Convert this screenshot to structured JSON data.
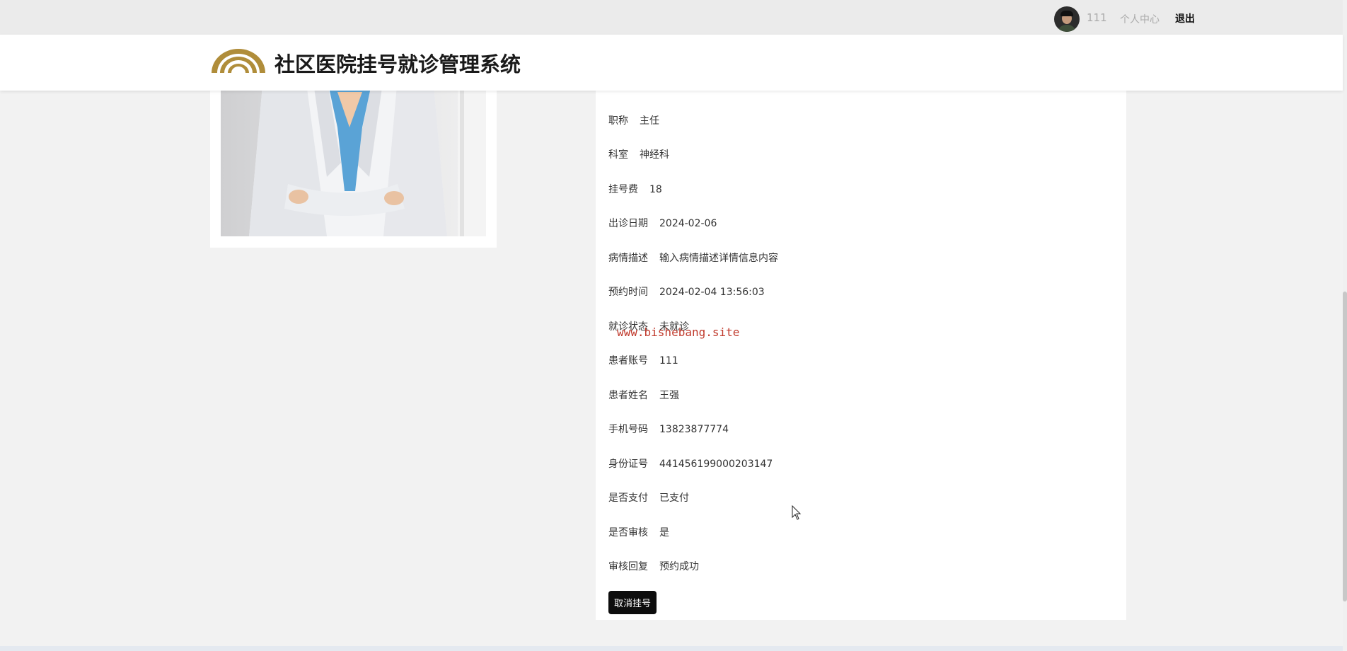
{
  "topbar": {
    "username": "111",
    "personal_center": "个人中心",
    "logout": "退出"
  },
  "header": {
    "title": "社区医院挂号就诊管理系统",
    "logo_color": "#b08d3a"
  },
  "details": [
    {
      "label": "职称",
      "value": "主任"
    },
    {
      "label": "科室",
      "value": "神经科"
    },
    {
      "label": "挂号费",
      "value": "18"
    },
    {
      "label": "出诊日期",
      "value": "2024-02-06"
    },
    {
      "label": "病情描述",
      "value": "输入病情描述详情信息内容"
    },
    {
      "label": "预约时间",
      "value": "2024-02-04 13:56:03"
    },
    {
      "label": "就诊状态",
      "value": "未就诊"
    },
    {
      "label": "患者账号",
      "value": "111"
    },
    {
      "label": "患者姓名",
      "value": "王强"
    },
    {
      "label": "手机号码",
      "value": "13823877774"
    },
    {
      "label": "身份证号",
      "value": "441456199000203147"
    },
    {
      "label": "是否支付",
      "value": "已支付"
    },
    {
      "label": "是否审核",
      "value": "是"
    },
    {
      "label": "审核回复",
      "value": "预约成功"
    }
  ],
  "actions": {
    "cancel_label": "取消挂号"
  },
  "watermark": "www.bishebang.site"
}
